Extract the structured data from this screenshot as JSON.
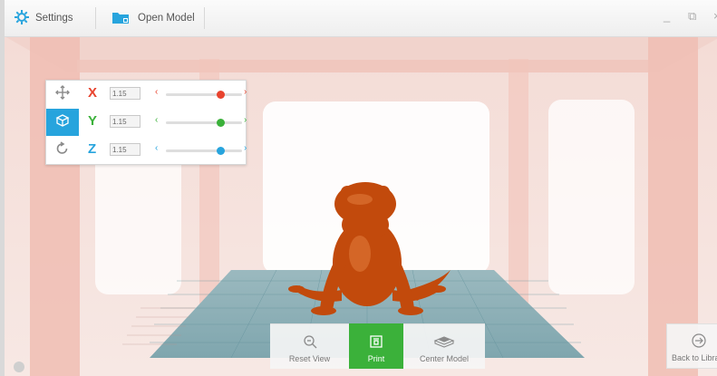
{
  "topbar": {
    "settings_label": "Settings",
    "open_model_label": "Open Model",
    "minimize": "_",
    "restore": "⧉",
    "close": "×"
  },
  "transform": {
    "x": {
      "label": "X",
      "value": "1.15",
      "color": "#e8432e",
      "level": 0.72
    },
    "y": {
      "label": "Y",
      "value": "1.15",
      "color": "#3bb13a",
      "level": 0.72
    },
    "z": {
      "label": "Z",
      "value": "1.15",
      "color": "#27a4dd",
      "level": 0.72
    },
    "left_arrow": "‹",
    "right_arrow": "›"
  },
  "bottom": {
    "reset_view": "Reset View",
    "print": "Print",
    "center_model": "Center Model",
    "back_to_library": "Back to Library"
  },
  "colors": {
    "accent_blue": "#27a4dd",
    "print_green": "#3bb13a",
    "model_orange": "#c24a0c",
    "grid_teal": "#6fa9b6"
  },
  "icons": [
    "settings-icon",
    "folder-icon",
    "move-icon",
    "scale-icon",
    "rotate-icon",
    "zoom-icon",
    "print-icon",
    "center-icon",
    "back-arrow-icon"
  ]
}
